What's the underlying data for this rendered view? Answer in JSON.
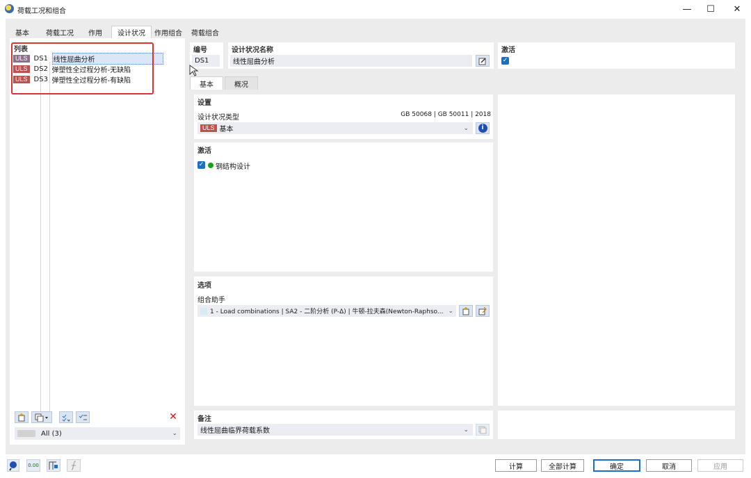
{
  "window": {
    "title": "荷载工况和组合",
    "min_glyph": "—",
    "max_glyph": "☐",
    "close_glyph": "✕"
  },
  "tabs": [
    {
      "label": "基本"
    },
    {
      "label": "荷载工况"
    },
    {
      "label": "作用"
    },
    {
      "label": "设计状况",
      "active": true
    },
    {
      "label": "作用组合"
    },
    {
      "label": "荷载组合"
    }
  ],
  "list": {
    "title": "列表",
    "items": [
      {
        "badge": "ULS",
        "code": "DS1",
        "name": "线性屈曲分析"
      },
      {
        "badge": "ULS",
        "code": "DS2",
        "name": "弹塑性全过程分析-无缺陷"
      },
      {
        "badge": "ULS",
        "code": "DS3",
        "name": "弹塑性全过程分析-有缺陷"
      }
    ],
    "filter_value": "All (3)",
    "delete_glyph": "✕"
  },
  "header": {
    "number_label": "编号",
    "number_value": "DS1",
    "name_label": "设计状况名称",
    "name_value": "线性屈曲分析",
    "active_label": "激活"
  },
  "subtabs": [
    {
      "label": "基本"
    },
    {
      "label": "概况"
    }
  ],
  "settings": {
    "title": "设置",
    "type_label": "设计状况类型",
    "standard": "GB 50068 | GB 50011 | 2018",
    "type_badge": "ULS",
    "type_value": "基本",
    "info_glyph": "i"
  },
  "activation": {
    "title": "激活",
    "item": "钢结构设计"
  },
  "options": {
    "title": "选项",
    "combo_label": "组合助手",
    "combo_value": "1 - Load combinations | SA2 - 二阶分析 (P-Δ) | 牛顿-拉夫森(Newton-Raphso..."
  },
  "notes": {
    "title": "备注",
    "value": "线性屈曲临界荷载系数"
  },
  "buttons": {
    "calc": "计算",
    "calc_all": "全部计算",
    "ok": "确定",
    "cancel": "取消",
    "apply": "应用"
  },
  "colors": {
    "accent": "#1e6fc1",
    "uls_badge": "#c0504d",
    "highlight_border": "#e03131"
  }
}
